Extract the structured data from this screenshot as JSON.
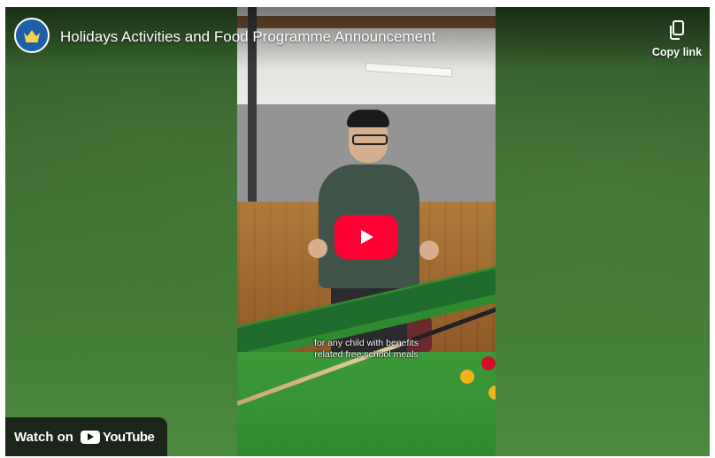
{
  "video": {
    "title": "Holidays Activities and Food Programme Announcement",
    "subtitle_lines": [
      "for any child with benefits",
      "related free school meals"
    ]
  },
  "actions": {
    "copy_link_label": "Copy link"
  },
  "footer": {
    "watch_on_label": "Watch on",
    "brand_label": "YouTube"
  },
  "icons": [
    "channel-logo",
    "copy-icon",
    "play-icon",
    "youtube-logo"
  ],
  "colors": {
    "play_button": "#ff0033",
    "background_green": "#3c6e33"
  }
}
